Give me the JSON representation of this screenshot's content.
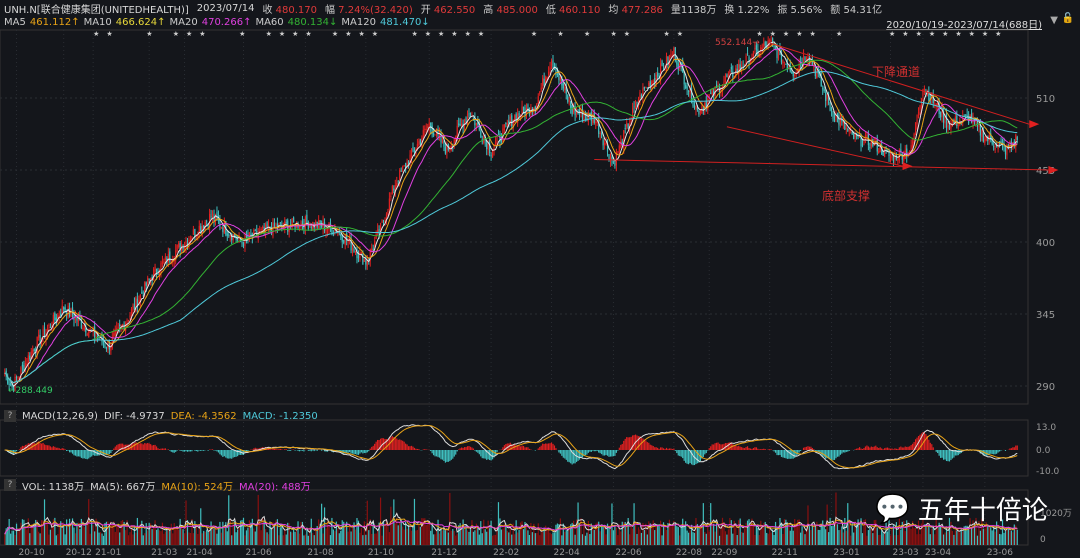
{
  "header": {
    "symbol": "UNH.N[联合健康集团(UNITEDHEALTH)]",
    "date": "2023/07/14",
    "close_label": "收",
    "close": "480.170",
    "chg_label": "幅",
    "chg": "7.24%(32.420)",
    "open_label": "开",
    "open": "462.550",
    "high_label": "高",
    "high": "485.000",
    "low_label": "低",
    "low": "460.110",
    "avg_label": "均",
    "avg": "477.286",
    "vol": "量1138万",
    "turnover": "换 1.22%",
    "amp": "振 5.56%",
    "amount": "额 54.31亿",
    "range": "2020/10/19-2023/07/14(688日)"
  },
  "ma": {
    "ma5_label": "MA5",
    "ma5": "461.112↑",
    "ma10_label": "MA10",
    "ma10": "466.624↑",
    "ma20_label": "MA20",
    "ma20": "470.266↑",
    "ma60_label": "MA60",
    "ma60": "480.134↓",
    "ma120_label": "MA120",
    "ma120": "481.470↓"
  },
  "macd": {
    "help": "?",
    "title": "MACD(12,26,9)",
    "dif": "DIF: -4.9737",
    "dea": "DEA: -4.3562",
    "macd": "MACD: -1.2350",
    "ticks": [
      "13.0",
      "0.0",
      "-10.0"
    ]
  },
  "vol": {
    "help": "?",
    "title": "VOL: 1138万",
    "ma5": "MA(5): 667万",
    "ma10": "MA(10): 524万",
    "ma20": "MA(20): 488万",
    "ticks": [
      "1020万",
      "0"
    ]
  },
  "annotations": {
    "high": "552.144",
    "low": "288.449",
    "channel": "下降通道",
    "support": "底部支撑"
  },
  "watermark": "五年十倍论",
  "colors": {
    "up": "#e02020",
    "down": "#3fbfbf",
    "ma5": "#e8e8e8",
    "ma10": "#e8a317",
    "ma20": "#e040e0",
    "ma60": "#33b233",
    "ma120": "#4fc9d9"
  },
  "chart_data": {
    "type": "candlestick",
    "title": "UNH.N 日K",
    "y_ticks": [
      290,
      345,
      400,
      455,
      510
    ],
    "ylim": [
      265,
      570
    ],
    "x_ticks": [
      {
        "label": "20-10",
        "day": 8
      },
      {
        "label": "20-12",
        "day": 40
      },
      {
        "label": "21-01",
        "day": 60
      },
      {
        "label": "21-03",
        "day": 98
      },
      {
        "label": "21-04",
        "day": 122
      },
      {
        "label": "21-06",
        "day": 162
      },
      {
        "label": "21-08",
        "day": 204
      },
      {
        "label": "21-10",
        "day": 245
      },
      {
        "label": "21-12",
        "day": 288
      },
      {
        "label": "22-02",
        "day": 330
      },
      {
        "label": "22-04",
        "day": 371
      },
      {
        "label": "22-06",
        "day": 413
      },
      {
        "label": "22-08",
        "day": 454
      },
      {
        "label": "22-09",
        "day": 478
      },
      {
        "label": "22-11",
        "day": 519
      },
      {
        "label": "23-01",
        "day": 561
      },
      {
        "label": "23-03",
        "day": 601
      },
      {
        "label": "23-04",
        "day": 623
      },
      {
        "label": "23-06",
        "day": 665
      }
    ],
    "close_anchors": [
      [
        0,
        300
      ],
      [
        5,
        289
      ],
      [
        20,
        320
      ],
      [
        40,
        350
      ],
      [
        55,
        335
      ],
      [
        70,
        320
      ],
      [
        85,
        345
      ],
      [
        100,
        375
      ],
      [
        122,
        400
      ],
      [
        140,
        420
      ],
      [
        160,
        400
      ],
      [
        180,
        410
      ],
      [
        204,
        415
      ],
      [
        225,
        410
      ],
      [
        245,
        385
      ],
      [
        255,
        410
      ],
      [
        265,
        445
      ],
      [
        288,
        490
      ],
      [
        300,
        470
      ],
      [
        315,
        500
      ],
      [
        330,
        470
      ],
      [
        345,
        495
      ],
      [
        360,
        505
      ],
      [
        371,
        540
      ],
      [
        385,
        500
      ],
      [
        400,
        495
      ],
      [
        413,
        460
      ],
      [
        430,
        510
      ],
      [
        454,
        545
      ],
      [
        470,
        500
      ],
      [
        490,
        525
      ],
      [
        505,
        540
      ],
      [
        519,
        552
      ],
      [
        535,
        530
      ],
      [
        545,
        545
      ],
      [
        561,
        500
      ],
      [
        575,
        480
      ],
      [
        590,
        475
      ],
      [
        601,
        465
      ],
      [
        615,
        470
      ],
      [
        623,
        520
      ],
      [
        640,
        490
      ],
      [
        655,
        495
      ],
      [
        665,
        480
      ],
      [
        680,
        470
      ],
      [
        687,
        480
      ]
    ],
    "trendlines": [
      {
        "name": "下降通道 upper",
        "from": [
          519,
          552
        ],
        "to": [
          687,
          490
        ]
      },
      {
        "name": "下降通道 lower",
        "from": [
          490,
          488
        ],
        "to": [
          601,
          458
        ]
      },
      {
        "name": "底部支撑",
        "from": [
          400,
          463
        ],
        "to": [
          700,
          455
        ]
      }
    ]
  }
}
